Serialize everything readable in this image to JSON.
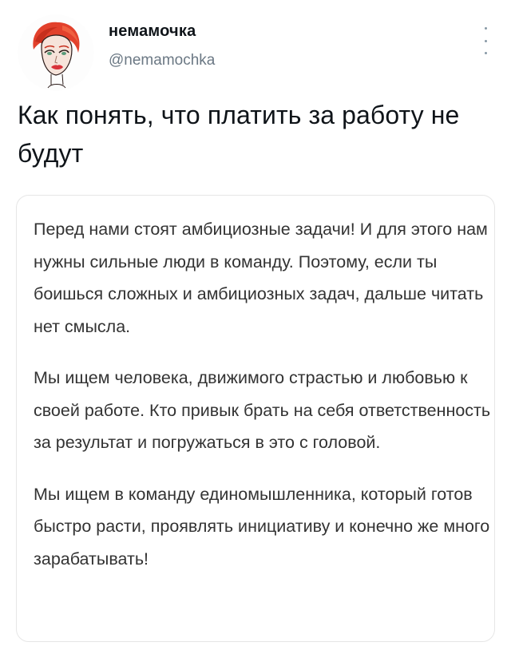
{
  "author": {
    "display_name": "немамочка",
    "handle": "@nemamochka"
  },
  "tweet": {
    "text": "Как понять, что платить за работу не будут"
  },
  "quoted_card": {
    "paragraphs": [
      "Перед нами стоят амбициозные задачи! И для этого нам нужны сильные люди в команду. Поэтому, если ты боишься сложных и амбициозных задач, дальше читать нет смысла.",
      "Мы ищем человека, движимого страстью и любовью к своей работе. Кто привык брать на себя ответственность за результат и погружаться в это с головой.",
      "Мы ищем в команду единомышленника, который готов быстро расти, проявлять инициативу и конечно же много зарабатывать!"
    ]
  },
  "icons": {
    "avatar": "cartoon-redhead-woman-avatar",
    "more": "vertical-ellipsis-icon"
  }
}
